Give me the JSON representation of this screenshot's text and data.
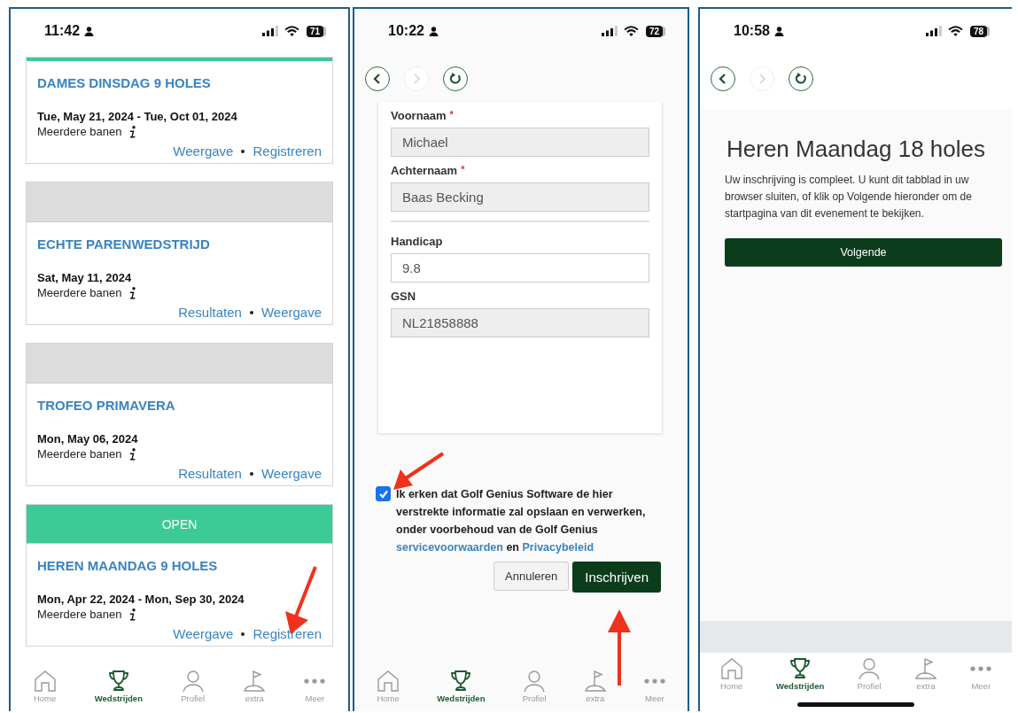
{
  "screens": [
    {
      "kind": "events",
      "status": {
        "time": "11:42",
        "battery": "71"
      },
      "events": [
        {
          "kind": "accent",
          "title": "DAMES DINSDAG 9 HOLES",
          "dates": "Tue, May 21, 2024 - Tue, Oct 01, 2024",
          "courses": "Meerdere banen",
          "links": [
            "Weergave",
            "Registreren"
          ]
        },
        {
          "kind": "blank",
          "title": "ECHTE PARENWEDSTRIJD",
          "dates": "Sat, May 11, 2024",
          "courses": "Meerdere banen",
          "links": [
            "Resultaten",
            "Weergave"
          ]
        },
        {
          "kind": "blank",
          "title": "TROFEO PRIMAVERA",
          "dates": "Mon, May 06, 2024",
          "courses": "Meerdere banen",
          "links": [
            "Resultaten",
            "Weergave"
          ]
        },
        {
          "kind": "open",
          "label": "OPEN",
          "title": "HEREN MAANDAG 9 HOLES",
          "dates": "Mon, Apr 22, 2024 - Mon, Sep 30, 2024",
          "courses": "Meerdere banen",
          "links": [
            "Weergave",
            "Registreren"
          ]
        }
      ],
      "tabs": [
        {
          "label": "Home",
          "selected": false
        },
        {
          "label": "Wedstrijden",
          "selected": true
        },
        {
          "label": "Profiel",
          "selected": false
        },
        {
          "label": "extra",
          "selected": false
        },
        {
          "label": "Meer",
          "selected": false
        }
      ]
    },
    {
      "kind": "form",
      "status": {
        "time": "10:22",
        "battery": "72"
      },
      "forward_disabled": true,
      "fields": [
        {
          "label": "Voornaam",
          "required_mark": "*",
          "readonly": true,
          "value": "Michael"
        },
        {
          "label": "Achternaam",
          "required_mark": "*",
          "readonly": true,
          "value": "Baas Becking"
        },
        {
          "label": "Handicap",
          "readonly": false,
          "value": "9.8",
          "divider": true
        },
        {
          "label": "GSN",
          "readonly": true,
          "value": "NL21858888"
        }
      ],
      "consent": {
        "checked": true,
        "text": "Ik erken dat Golf Genius Software de hier verstrekte informatie zal opslaan en verwerken, onder voorbehoud van de Golf Genius",
        "terms_link": "servicevoorwaarden",
        "joiner": "en",
        "privacy_link": "Privacybeleid"
      },
      "buttons": [
        {
          "kind": "secondary",
          "label": "Annuleren"
        },
        {
          "kind": "primary",
          "label": "Inschrijven"
        }
      ],
      "tabs": [
        {
          "label": "Home",
          "selected": false
        },
        {
          "label": "Wedstrijden",
          "selected": true
        },
        {
          "label": "Profiel",
          "selected": false
        },
        {
          "label": "extra",
          "selected": false
        },
        {
          "label": "Meer",
          "selected": false
        }
      ]
    },
    {
      "kind": "confirmation",
      "status": {
        "time": "10:58",
        "battery": "78"
      },
      "forward_disabled": true,
      "title": "Heren Maandag 18 holes",
      "message": "Uw inschrijving is compleet. U kunt dit tabblad in uw browser sluiten, of klik op Volgende hieronder om de startpagina van dit evenement te bekijken.",
      "button": "Volgende",
      "tabs": [
        {
          "label": "Home",
          "selected": false
        },
        {
          "label": "Wedstrijden",
          "selected": true
        },
        {
          "label": "Profiel",
          "selected": false
        },
        {
          "label": "extra",
          "selected": false
        },
        {
          "label": "Meer",
          "selected": false
        }
      ]
    }
  ]
}
